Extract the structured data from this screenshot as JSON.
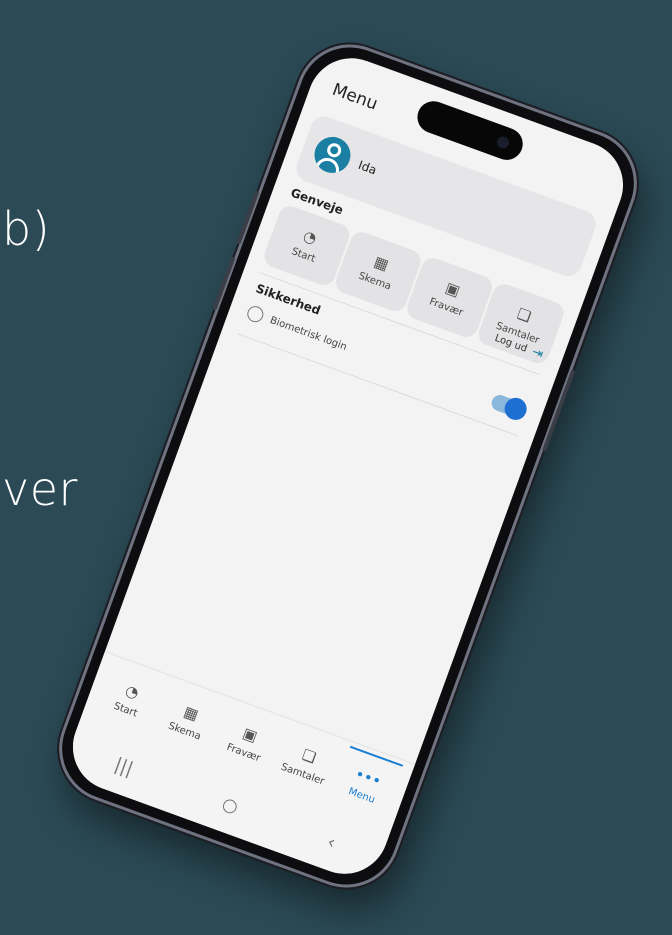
{
  "background": {
    "color": "#2b4a55",
    "text_fragments": [
      "b)",
      "ver"
    ]
  },
  "screen": {
    "title": "Menu",
    "profile": {
      "name": "Ida",
      "avatar_color": "#1a7fa2",
      "avatar_icon": "person-icon"
    },
    "shortcuts_label": "Genveje",
    "shortcuts": [
      {
        "label": "Start",
        "icon": "gauge-icon"
      },
      {
        "label": "Skema",
        "icon": "calendar-icon"
      },
      {
        "label": "Fravær",
        "icon": "calendar-check-icon"
      },
      {
        "label": "Samtaler",
        "icon": "chat-icon"
      }
    ],
    "logout": {
      "label": "Log ud",
      "icon": "logout-icon",
      "color": "#1a7fa2"
    },
    "security_label": "Sikkerhed",
    "biometric": {
      "label": "Biometrisk login",
      "icon": "fingerprint-icon",
      "enabled": true,
      "accent": "#1d6fd1"
    }
  },
  "tabbar": {
    "items": [
      {
        "label": "Start",
        "icon": "gauge-icon",
        "active": false
      },
      {
        "label": "Skema",
        "icon": "calendar-icon",
        "active": false
      },
      {
        "label": "Fravær",
        "icon": "calendar-check-icon",
        "active": false
      },
      {
        "label": "Samtaler",
        "icon": "chat-icon",
        "active": false
      },
      {
        "label": "Menu",
        "icon": "more-icon",
        "active": true
      }
    ],
    "active_color": "#1a7fd1"
  },
  "system_nav": [
    {
      "icon": "recents-icon",
      "glyph": "|||"
    },
    {
      "icon": "home-icon",
      "glyph": "○"
    },
    {
      "icon": "back-icon",
      "glyph": "‹"
    }
  ]
}
